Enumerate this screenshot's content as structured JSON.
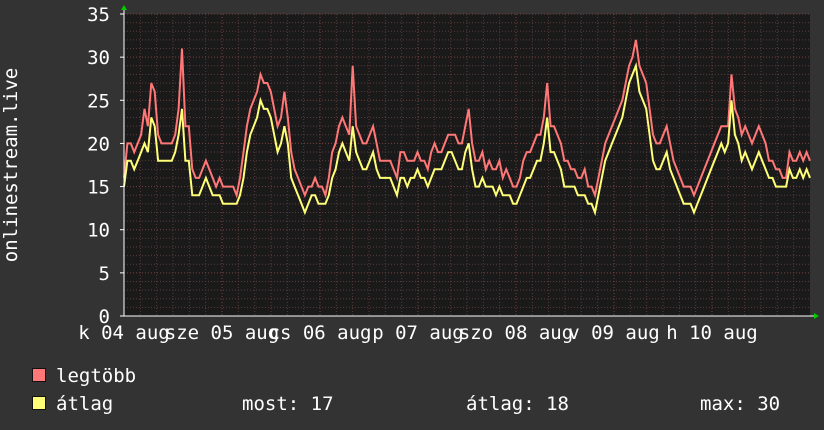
{
  "chart_data": {
    "type": "line",
    "ylabel": "onlinestream.live",
    "ylim": [
      0,
      35
    ],
    "y_ticks": [
      "0",
      "5",
      "10",
      "15",
      "20",
      "25",
      "30",
      "35"
    ],
    "x_tick_labels": [
      "k 04 aug",
      "sze 05 aug",
      "cs 06 aug",
      "p 07 aug",
      "szo 08 aug",
      "v 09 aug",
      "h 10 aug"
    ],
    "grid": true,
    "colors": {
      "max": "#ff7777",
      "avg": "#ffff77",
      "grid_minor": "#5a3a3a",
      "grid_major": "#7a4040",
      "plot_bg": "#1a1a1a"
    },
    "series": [
      {
        "name": "legtöbb",
        "values": [
          16,
          20,
          20,
          19,
          20,
          21,
          24,
          22,
          27,
          26,
          21,
          20,
          20,
          20,
          20,
          21,
          24,
          31,
          22,
          22,
          17,
          16,
          16,
          17,
          18,
          17,
          16,
          15,
          16,
          15,
          15,
          15,
          15,
          14,
          16,
          19,
          22,
          24,
          25,
          26,
          28,
          27,
          27,
          26,
          24,
          22,
          23,
          26,
          23,
          19,
          17,
          16,
          15,
          14,
          15,
          15,
          16,
          15,
          15,
          14,
          16,
          19,
          20,
          22,
          23,
          22,
          21,
          29,
          22,
          21,
          20,
          20,
          21,
          22,
          20,
          18,
          18,
          18,
          18,
          17,
          16,
          19,
          19,
          18,
          18,
          18,
          19,
          18,
          18,
          17,
          19,
          20,
          19,
          19,
          20,
          21,
          21,
          21,
          20,
          20,
          22,
          24,
          20,
          18,
          18,
          19,
          17,
          18,
          17,
          17,
          18,
          16,
          17,
          16,
          15,
          15,
          16,
          18,
          19,
          19,
          20,
          21,
          21,
          23,
          27,
          22,
          22,
          21,
          20,
          18,
          18,
          17,
          17,
          16,
          16,
          17,
          15,
          15,
          14,
          16,
          18,
          20,
          21,
          22,
          23,
          24,
          25,
          27,
          29,
          30,
          32,
          29,
          28,
          27,
          24,
          21,
          20,
          20,
          21,
          22,
          20,
          18,
          17,
          16,
          15,
          15,
          15,
          14,
          15,
          16,
          17,
          18,
          19,
          20,
          21,
          22,
          22,
          22,
          28,
          24,
          23,
          21,
          22,
          21,
          20,
          21,
          22,
          21,
          20,
          18,
          18,
          17,
          17,
          16,
          16,
          19,
          18,
          18,
          19,
          18,
          19,
          18
        ]
      },
      {
        "name": "átlag",
        "values": [
          15,
          18,
          18,
          17,
          18,
          19,
          20,
          19,
          23,
          22,
          18,
          18,
          18,
          18,
          18,
          19,
          21,
          24,
          18,
          18,
          14,
          14,
          14,
          15,
          16,
          15,
          14,
          14,
          14,
          13,
          13,
          13,
          13,
          13,
          14,
          16,
          19,
          21,
          22,
          23,
          25,
          24,
          24,
          23,
          21,
          19,
          20,
          22,
          20,
          16,
          15,
          14,
          13,
          12,
          13,
          14,
          14,
          13,
          13,
          13,
          14,
          16,
          17,
          19,
          20,
          19,
          18,
          22,
          19,
          18,
          17,
          17,
          18,
          19,
          17,
          16,
          16,
          16,
          16,
          15,
          14,
          16,
          16,
          15,
          16,
          16,
          17,
          16,
          16,
          15,
          16,
          17,
          17,
          17,
          18,
          19,
          19,
          18,
          17,
          17,
          19,
          20,
          17,
          15,
          15,
          16,
          15,
          15,
          15,
          14,
          15,
          14,
          14,
          14,
          13,
          13,
          14,
          15,
          16,
          16,
          17,
          18,
          18,
          20,
          23,
          19,
          19,
          18,
          17,
          15,
          15,
          15,
          15,
          14,
          14,
          14,
          13,
          13,
          12,
          14,
          16,
          18,
          19,
          20,
          21,
          22,
          23,
          25,
          27,
          28,
          29,
          26,
          25,
          24,
          21,
          18,
          17,
          17,
          18,
          19,
          17,
          16,
          15,
          14,
          13,
          13,
          13,
          12,
          13,
          14,
          15,
          16,
          17,
          18,
          19,
          20,
          19,
          20,
          25,
          21,
          20,
          18,
          19,
          18,
          17,
          18,
          19,
          18,
          17,
          16,
          16,
          15,
          15,
          15,
          15,
          17,
          16,
          16,
          17,
          16,
          17,
          16
        ]
      }
    ]
  },
  "legend": {
    "max_label": "legtöbb",
    "avg_label": "átlag",
    "now_text": "most: 17",
    "avg_text": "átlag: 18",
    "max_text": "max: 30"
  }
}
